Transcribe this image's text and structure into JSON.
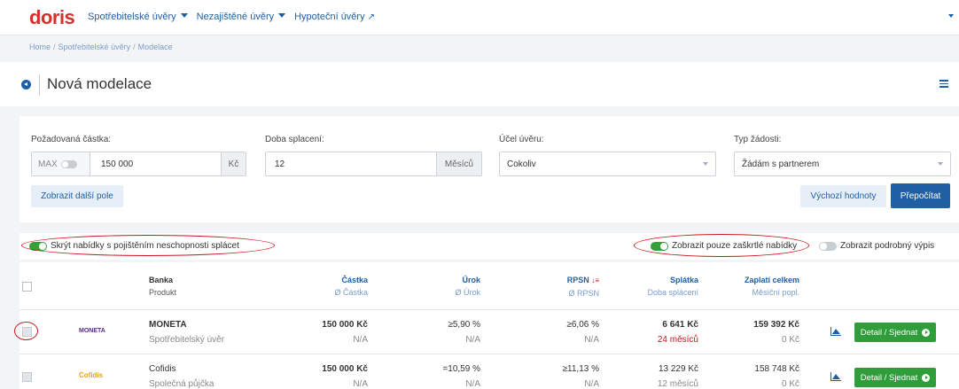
{
  "brand": "doris",
  "nav": {
    "items": [
      {
        "label": "Spotřebitelské úvěry",
        "icon": "caret-down-icon"
      },
      {
        "label": "Nezajištěné úvěry",
        "icon": "caret-down-icon"
      },
      {
        "label": "Hypoteční úvěry",
        "icon": "external-link-icon"
      }
    ],
    "external_glyph": "↗"
  },
  "breadcrumb": {
    "items": [
      "Home",
      "Spotřebitelské úvěry",
      "Modelace"
    ],
    "separator": "/"
  },
  "page_title": "Nová modelace",
  "form": {
    "amount": {
      "label": "Požadovaná částka:",
      "max_label": "MAX",
      "value": "150 000",
      "unit": "Kč",
      "max_enabled": false
    },
    "term": {
      "label": "Doba splacení:",
      "value": "12",
      "unit": "Měsíců"
    },
    "purpose": {
      "label": "Účel úvěru:",
      "value": "Cokoliv"
    },
    "request_type": {
      "label": "Typ žádosti:",
      "value": "Žádám s partnerem"
    },
    "more_fields_label": "Zobrazit další pole",
    "defaults_label": "Výchozí hodnoty",
    "recalc_label": "Přepočítat"
  },
  "switches": {
    "hide_insurance": {
      "label": "Skrýt nabídky s pojištěním neschopnosti splácet",
      "on": true
    },
    "only_checked": {
      "label": "Zobrazit pouze zaškrtlé nabídky",
      "on": true
    },
    "detailed": {
      "label": "Zobrazit podrobný výpis",
      "on": false
    }
  },
  "table": {
    "columns": [
      {
        "h1": "Banka",
        "h2": "Produkt"
      },
      {
        "h1": "Částka",
        "h2": "Ø Částka"
      },
      {
        "h1": "Úrok",
        "h2": "Ø Úrok"
      },
      {
        "h1": "RPSN",
        "h2": "Ø RPSN",
        "sort_glyph": "↓≡"
      },
      {
        "h1": "Splátka",
        "h2": "Doba splácení"
      },
      {
        "h1": "Zaplatí celkem",
        "h2": "Měsíční popl."
      }
    ],
    "rows": [
      {
        "logo": "MONETA",
        "logo_color": "#5a2a82",
        "bank": "MONETA",
        "product": "Spotřebitelský úvěr",
        "amount": "150 000 Kč",
        "amount_avg": "N/A",
        "rate": "≥5,90 %",
        "rate_avg": "N/A",
        "rpsn": "≥6,06 %",
        "rpsn_avg": "N/A",
        "installment": "6 641 Kč",
        "term": "24 měsíců",
        "term_highlight": true,
        "total": "159 392 Kč",
        "fee": "0 Kč",
        "action": "Detail / Sjednat"
      },
      {
        "logo": "Cofidis",
        "logo_color": "#e8a317",
        "bank": "Cofidis",
        "product": "Společná půjčka",
        "amount": "150 000 Kč",
        "amount_avg": "N/A",
        "rate": "=10,59 %",
        "rate_avg": "N/A",
        "rpsn": "≥11,13 %",
        "rpsn_avg": "N/A",
        "installment": "13 229 Kč",
        "term": "12 měsíců",
        "term_highlight": false,
        "total": "158 748 Kč",
        "fee": "0 Kč",
        "action": "Detail / Sjednat"
      }
    ]
  },
  "colors": {
    "brand_red": "#d6302c",
    "primary_blue": "#1f5fa3",
    "green": "#2e9d3a",
    "annotation_red": "#c9161c"
  }
}
